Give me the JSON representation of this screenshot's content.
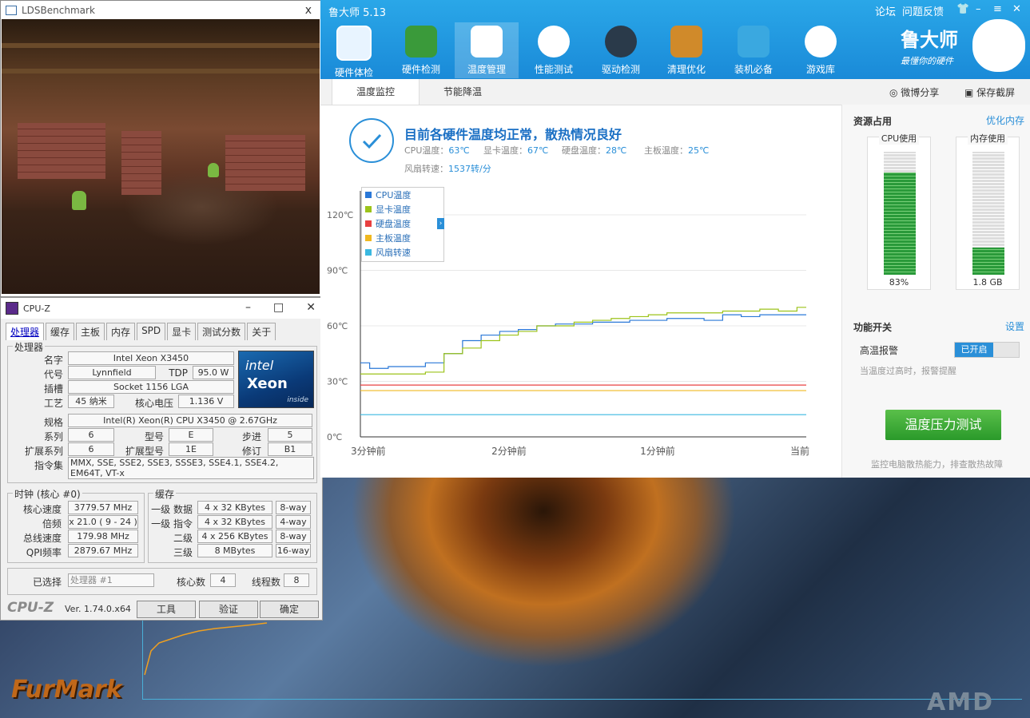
{
  "lds": {
    "title": "LDSBenchmark",
    "close": "x"
  },
  "cpuz": {
    "title": "CPU-Z",
    "tabs": [
      "处理器",
      "缓存",
      "主板",
      "内存",
      "SPD",
      "显卡",
      "测试分数",
      "关于"
    ],
    "processor_group": "处理器",
    "labels": {
      "name": "名字",
      "codename": "代号",
      "tdp": "TDP",
      "package": "插槽",
      "tech": "工艺",
      "voltage": "核心电压",
      "spec": "规格",
      "family": "系列",
      "model": "型号",
      "stepping": "步进",
      "ext_family": "扩展系列",
      "ext_model": "扩展型号",
      "revision": "修订",
      "instructions": "指令集"
    },
    "values": {
      "name": "Intel Xeon X3450",
      "codename": "Lynnfield",
      "tdp": "95.0 W",
      "package": "Socket 1156 LGA",
      "tech": "45 纳米",
      "voltage": "1.136 V",
      "spec": "Intel(R) Xeon(R) CPU        X3450  @ 2.67GHz",
      "family": "6",
      "model": "E",
      "stepping": "5",
      "ext_family": "6",
      "ext_model": "1E",
      "revision": "B1",
      "instructions": "MMX, SSE, SSE2, SSE3, SSSE3, SSE4.1, SSE4.2, EM64T, VT-x"
    },
    "clock_group": "时钟 (核心 #0)",
    "clock_labels": [
      "核心速度",
      "倍频",
      "总线速度",
      "QPI频率"
    ],
    "clock_values": [
      "3779.57 MHz",
      "x 21.0 ( 9 - 24 )",
      "179.98 MHz",
      "2879.67 MHz"
    ],
    "cache_group": "缓存",
    "cache_labels": [
      "一级 数据",
      "一级 指令",
      "二级",
      "三级"
    ],
    "cache_sizes": [
      "4 x 32 KBytes",
      "4 x 32 KBytes",
      "4 x 256 KBytes",
      "8 MBytes"
    ],
    "cache_ways": [
      "8-way",
      "4-way",
      "8-way",
      "16-way"
    ],
    "selected_label": "已选择",
    "selected_value": "处理器 #1",
    "cores_label": "核心数",
    "cores": "4",
    "threads_label": "线程数",
    "threads": "8",
    "brand": "CPU-Z",
    "version": "Ver. 1.74.0.x64",
    "tools_btn": "工具",
    "validate_btn": "验证",
    "ok_btn": "确定",
    "badge": {
      "intel": "intel",
      "xeon": "Xeon",
      "inside": "inside"
    }
  },
  "ludashi": {
    "title": "鲁大师 5.13",
    "header_links": [
      "论坛",
      "问题反馈"
    ],
    "nav": [
      "硬件体检",
      "硬件检测",
      "温度管理",
      "性能测试",
      "驱动检测",
      "清理优化",
      "装机必备",
      "游戏库"
    ],
    "brand": "鲁大师",
    "brand_sub": "最懂你的硬件",
    "subtabs": [
      "温度监控",
      "节能降温"
    ],
    "share": "微博分享",
    "screenshot": "保存截屏",
    "status_title": "目前各硬件温度均正常，散热情况良好",
    "temps": [
      {
        "label": "CPU温度：",
        "value": "63℃"
      },
      {
        "label": "显卡温度：",
        "value": "67℃"
      },
      {
        "label": "硬盘温度：",
        "value": "28℃"
      },
      {
        "label": "主板温度：",
        "value": "25℃"
      }
    ],
    "fan_label": "风扇转速：",
    "fan_value": "1537转/分",
    "resources_title": "资源占用",
    "optimize_link": "优化内存",
    "cpu_usage_label": "CPU使用",
    "cpu_usage": "83%",
    "cpu_usage_fraction": 0.83,
    "mem_usage_label": "内存使用",
    "mem_usage": "1.8 GB",
    "mem_usage_fraction": 0.22,
    "features_title": "功能开关",
    "settings_link": "设置",
    "alarm_label": "高温报警",
    "alarm_state": "已开启",
    "alarm_desc": "当温度过高时，报警提醒",
    "stress_btn": "温度压力测试",
    "stress_desc": "监控电脑散热能力，排查散热故障"
  },
  "chart_data": {
    "type": "line",
    "xlabels": [
      "3分钟前",
      "2分钟前",
      "1分钟前",
      "当前"
    ],
    "yticks": [
      "120℃",
      "90℃",
      "60℃",
      "30℃",
      "0℃"
    ],
    "ylim": [
      0,
      120
    ],
    "series": [
      {
        "name": "CPU温度",
        "color": "#2a78d8",
        "values": [
          40,
          37,
          38,
          38,
          40,
          45,
          52,
          55,
          57,
          58,
          60,
          61,
          61,
          62,
          62,
          63,
          63,
          64,
          64,
          63,
          66,
          65,
          66,
          66,
          66
        ]
      },
      {
        "name": "显卡温度",
        "color": "#9cc31a",
        "values": [
          34,
          34,
          34,
          34,
          35,
          45,
          48,
          52,
          55,
          57,
          60,
          60,
          62,
          63,
          64,
          65,
          66,
          67,
          67,
          67,
          68,
          68,
          69,
          68,
          70
        ]
      },
      {
        "name": "硬盘温度",
        "color": "#e84040",
        "values": [
          28,
          28,
          28,
          28,
          28,
          28,
          28,
          28,
          28,
          28,
          28,
          28,
          28,
          28,
          28,
          28,
          28,
          28,
          28,
          28,
          28,
          28,
          28,
          28,
          28
        ]
      },
      {
        "name": "主板温度",
        "color": "#f0b820",
        "values": [
          25,
          25,
          25,
          25,
          25,
          25,
          25,
          25,
          25,
          25,
          25,
          25,
          25,
          25,
          25,
          25,
          25,
          25,
          25,
          25,
          25,
          25,
          25,
          25,
          25
        ]
      },
      {
        "name": "风扇转速",
        "color": "#3ab8e0",
        "values": [
          12,
          12,
          12,
          12,
          12,
          12,
          12,
          12,
          12,
          12,
          12,
          12,
          12,
          12,
          12,
          12,
          12,
          12,
          12,
          12,
          12,
          12,
          12,
          12,
          12
        ]
      }
    ]
  },
  "desktop": {
    "furmark": "FurMark",
    "amd": "AMD"
  }
}
